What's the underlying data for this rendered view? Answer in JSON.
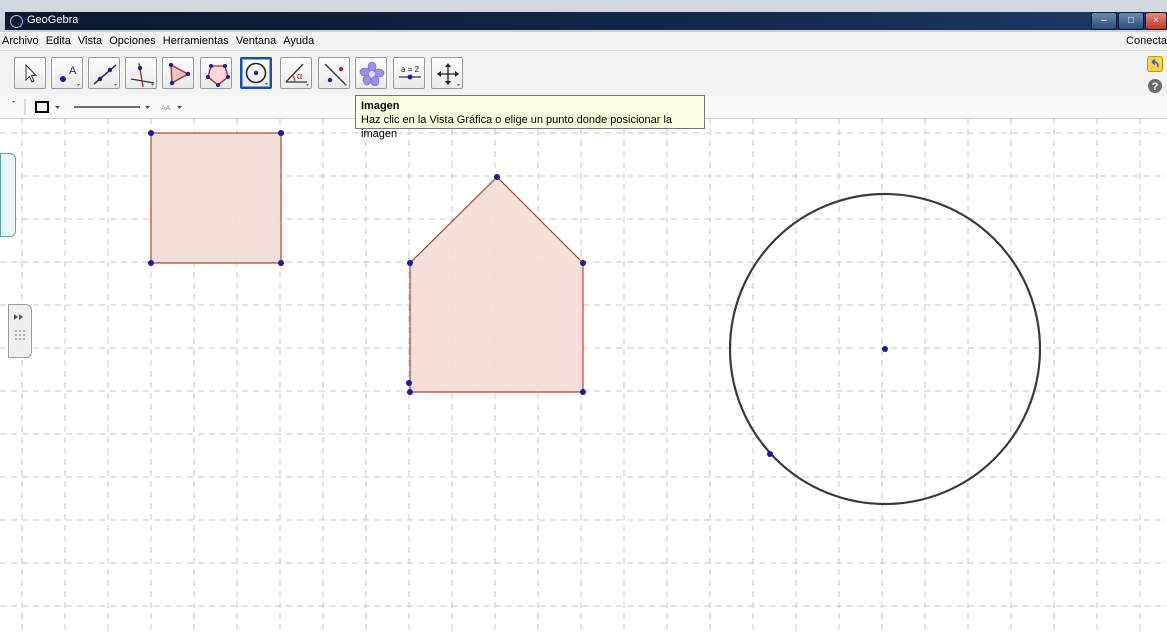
{
  "window": {
    "title": "GeoGebra"
  },
  "menu": {
    "items": [
      "Archivo",
      "Edita",
      "Vista",
      "Opciones",
      "Herramientas",
      "Ventana",
      "Ayuda"
    ],
    "connect": "Conecta"
  },
  "toolbar": {
    "tools": [
      {
        "name": "move-tool",
        "icon": "arrow-cursor-icon"
      },
      {
        "name": "point-tool",
        "icon": "point-icon"
      },
      {
        "name": "line-tool",
        "icon": "line-through-points-icon"
      },
      {
        "name": "perpendicular-tool",
        "icon": "perpendicular-line-icon"
      },
      {
        "name": "polygon-tool",
        "icon": "polygon-icon"
      },
      {
        "name": "circle-tool",
        "icon": "circle-through-points-icon"
      },
      {
        "name": "conic-tool",
        "icon": "circle-center-point-icon",
        "active": true
      },
      {
        "name": "angle-tool",
        "icon": "angle-icon"
      },
      {
        "name": "reflect-tool",
        "icon": "reflect-icon"
      },
      {
        "name": "image-tool",
        "icon": "flower-image-icon"
      },
      {
        "name": "slider-tool",
        "icon": "slider-icon",
        "label": "a = 2"
      },
      {
        "name": "move-view-tool",
        "icon": "move-cross-icon"
      }
    ],
    "colors": {
      "active_border": "#1d4fa8",
      "polygon_fill": "#f2ddd6",
      "polygon_stroke": "#b24a1e",
      "point": "#1a1aa6"
    }
  },
  "stylebar": {
    "text_size_label": "AA"
  },
  "tooltip": {
    "title": "Imagen",
    "text": "Haz clic en la Vista Gráfica o elige un punto donde posicionar la imagen"
  }
}
